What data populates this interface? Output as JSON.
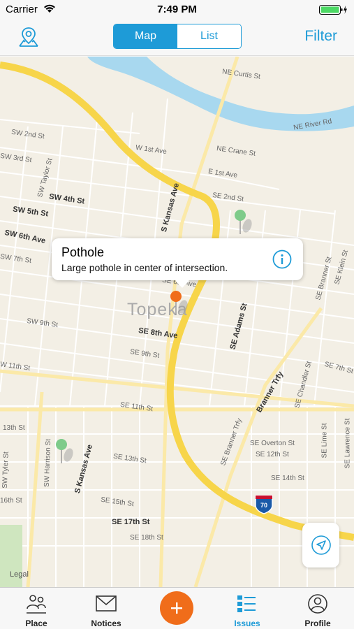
{
  "status": {
    "carrier": "Carrier",
    "time": "7:49 PM"
  },
  "nav": {
    "segments": [
      "Map",
      "List"
    ],
    "active_segment": "Map",
    "filter_label": "Filter"
  },
  "map": {
    "city_label": "Topeka",
    "legal_label": "Legal",
    "interstate_shield": "70",
    "streets": [
      "NE Curtis St",
      "NE River Rd",
      "SW 2nd St",
      "SW 3rd St",
      "W 1st Ave",
      "NE Crane St",
      "E 1st Ave",
      "SE 2nd St",
      "SW Taylor St",
      "SW 4th St",
      "SW 5th St",
      "SW 6th Ave",
      "SW 7th St",
      "SW 9th St",
      "SE 6th Ave",
      "SE 8th Ave",
      "SE 9th St",
      "S Kansas Ave",
      "SE Adams St",
      "SE Branner St",
      "SE Klein St",
      "Branner Trfy",
      "SE Chandler St",
      "SE 7th St",
      "SE 11th St",
      "W 11th St",
      "13th St",
      "SW Harrison St",
      "SW Tyler St",
      "S Kansas Ave",
      "SE 13th St",
      "SE 15th St",
      "SE 17th St",
      "SE 18th St",
      "SE Overton St",
      "SE 12th St",
      "SE 14th St",
      "SE Lime St",
      "SE Lawrence St",
      "SE Branner Trfy",
      "16th St"
    ],
    "callout": {
      "title": "Pothole",
      "description": "Large pothole in center of intersection."
    },
    "pins": [
      {
        "color": "#7ecb8a",
        "label": "issue-pin"
      },
      {
        "color": "#f06d1a",
        "label": "issue-pin"
      },
      {
        "color": "#7ecb8a",
        "label": "issue-pin"
      }
    ]
  },
  "tabs": [
    {
      "label": "Place",
      "icon": "people-location-icon",
      "active": false
    },
    {
      "label": "Notices",
      "icon": "envelope-icon",
      "active": false
    },
    {
      "label": "",
      "icon": "plus-icon",
      "active": false
    },
    {
      "label": "Issues",
      "icon": "list-icon",
      "active": true
    },
    {
      "label": "Profile",
      "icon": "person-circle-icon",
      "active": false
    }
  ],
  "colors": {
    "accent": "#1e9bd7",
    "add_button": "#f06d1a",
    "highway": "#f7d54a",
    "river": "#a8d8ef"
  }
}
